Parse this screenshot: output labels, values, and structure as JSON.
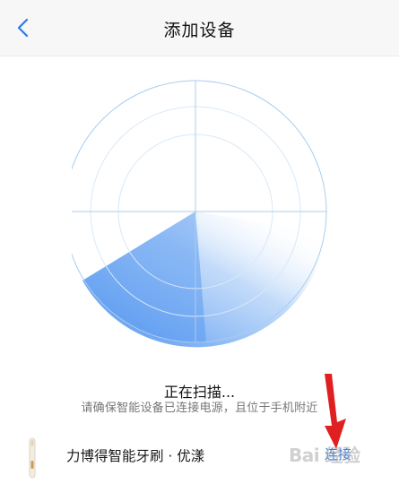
{
  "header": {
    "title": "添加设备",
    "back_icon": "chevron-left-icon"
  },
  "radar": {
    "line_color": "#a9cdef",
    "sweep_color": "#5b9bf0"
  },
  "status": {
    "title": "正在扫描...",
    "hint": "请确保智能设备已连接电源，且位于手机附近"
  },
  "device": {
    "name": "力博得智能牙刷 · 优漾",
    "icon": "toothbrush-icon",
    "connect_label": "连接"
  },
  "annotation": {
    "icon": "red-arrow-icon",
    "color": "#e02020"
  },
  "watermark": {
    "text": "Bai 经验"
  },
  "colors": {
    "accent": "#2b7ae8",
    "header_bg": "#f7f7f7"
  }
}
